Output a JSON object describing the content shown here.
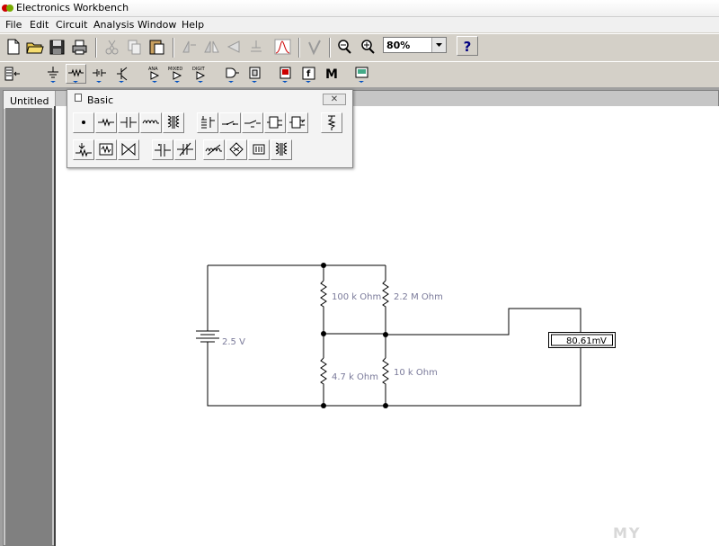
{
  "window": {
    "title": "Electronics Workbench"
  },
  "menu": [
    "File",
    "Edit",
    "Circuit",
    "Analysis",
    "Window",
    "Help"
  ],
  "zoom": {
    "value": "80%"
  },
  "help": {
    "label": "?"
  },
  "toolbar2": {
    "ana": "ANA",
    "mixed": "MIXED",
    "digit": "DIGIT",
    "m_label": "M",
    "f_label": "f"
  },
  "document": {
    "tab_title": "Untitled"
  },
  "palette": {
    "title": "Basic",
    "close": "✕"
  },
  "circuit": {
    "battery_label": "2.5 V",
    "r1_label": "100 k Ohm",
    "r2_label": "2.2 M Ohm",
    "r3_label": "4.7 k Ohm",
    "r4_label": "10 k Ohm",
    "meter_reading": "80.61m",
    "meter_unit": "V"
  },
  "watermark": "MY"
}
